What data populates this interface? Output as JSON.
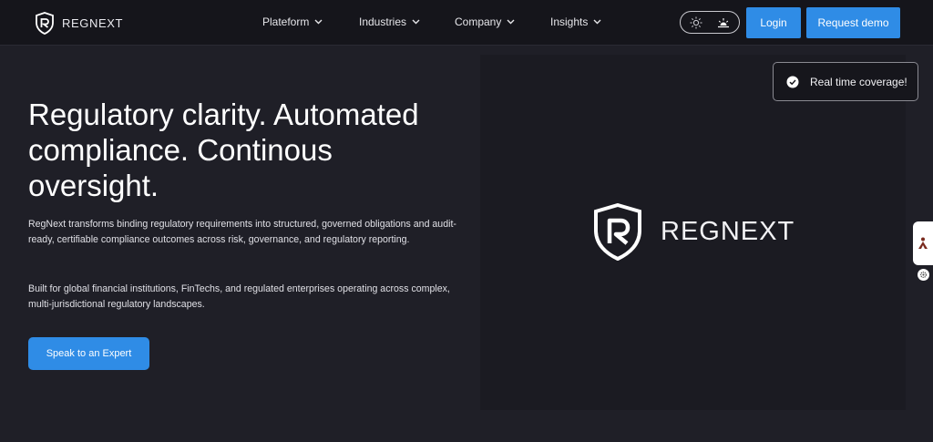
{
  "brand": {
    "name": "REGNEXT"
  },
  "nav": {
    "items": [
      {
        "label": "Plateform"
      },
      {
        "label": "Industries"
      },
      {
        "label": "Company"
      },
      {
        "label": "Insights"
      }
    ],
    "login_label": "Login",
    "demo_label": "Request demo"
  },
  "theme_toggle": {
    "light_icon": "sun-icon",
    "dark_icon": "sunset-icon"
  },
  "hero": {
    "title": "Regulatory clarity. Automated compliance. Continous oversight.",
    "paragraph1": "RegNext transforms binding regulatory requirements into structured, governed obligations and audit-ready, certifiable compliance outcomes across risk, governance, and regulatory reporting.",
    "paragraph2": "Built for global financial institutions, FinTechs, and regulated enterprises operating across complex, multi-jurisdictional regulatory landscapes.",
    "cta_label": "Speak to an Expert"
  },
  "showcase": {
    "logo_name": "REGNEXT"
  },
  "toast": {
    "text": "Real time coverage!",
    "icon": "check-circle-icon"
  },
  "colors": {
    "background": "#1f1f27",
    "accent": "#2f8ce6",
    "nav_bg": "#15151b"
  }
}
